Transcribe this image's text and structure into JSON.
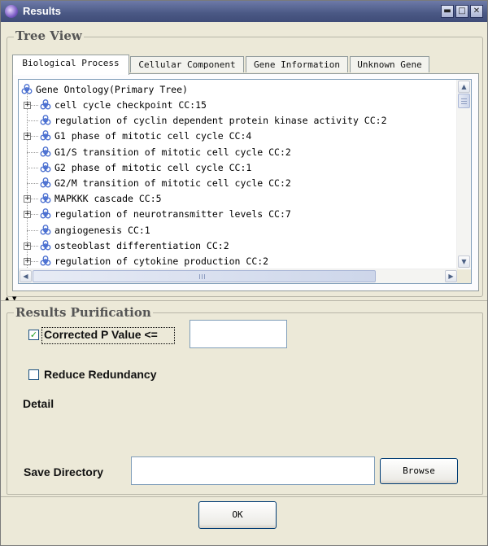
{
  "window": {
    "title": "Results",
    "controls": {
      "minimize": "▬",
      "maximize": "□",
      "close": "✕"
    }
  },
  "tree_view": {
    "group_title": "Tree View",
    "tabs": [
      {
        "label": "Biological Process",
        "active": true
      },
      {
        "label": "Cellular Component",
        "active": false
      },
      {
        "label": "Gene Information",
        "active": false
      },
      {
        "label": "Unknown Gene",
        "active": false
      }
    ],
    "root": "Gene Ontology(Primary Tree)",
    "items": [
      {
        "label": "cell cycle checkpoint CC:15",
        "expandable": true
      },
      {
        "label": "regulation of cyclin dependent protein kinase activity CC:2",
        "expandable": false
      },
      {
        "label": "G1 phase of mitotic cell cycle CC:4",
        "expandable": true
      },
      {
        "label": "G1/S transition of mitotic cell cycle CC:2",
        "expandable": false
      },
      {
        "label": "G2 phase of mitotic cell cycle CC:1",
        "expandable": false
      },
      {
        "label": "G2/M transition of mitotic cell cycle CC:2",
        "expandable": false
      },
      {
        "label": "MAPKKK cascade CC:5",
        "expandable": true
      },
      {
        "label": "regulation of neurotransmitter levels CC:7",
        "expandable": true
      },
      {
        "label": "angiogenesis CC:1",
        "expandable": false
      },
      {
        "label": "osteoblast differentiation CC:2",
        "expandable": true
      },
      {
        "label": "regulation of cytokine production CC:2",
        "expandable": true
      }
    ]
  },
  "purification": {
    "group_title": "Results Purification",
    "corrected_p": {
      "label": "Corrected P Value <=",
      "checked": true,
      "value": ""
    },
    "reduce_redundancy": {
      "label": "Reduce Redundancy",
      "checked": false
    },
    "detail_label": "Detail",
    "save_directory": {
      "label": "Save Directory",
      "value": "",
      "browse_label": "Browse"
    }
  },
  "footer": {
    "ok_label": "OK"
  },
  "colors": {
    "title_bar": "#4a5884",
    "check_mark": "#21a121",
    "window_bg": "#ece9d8"
  }
}
